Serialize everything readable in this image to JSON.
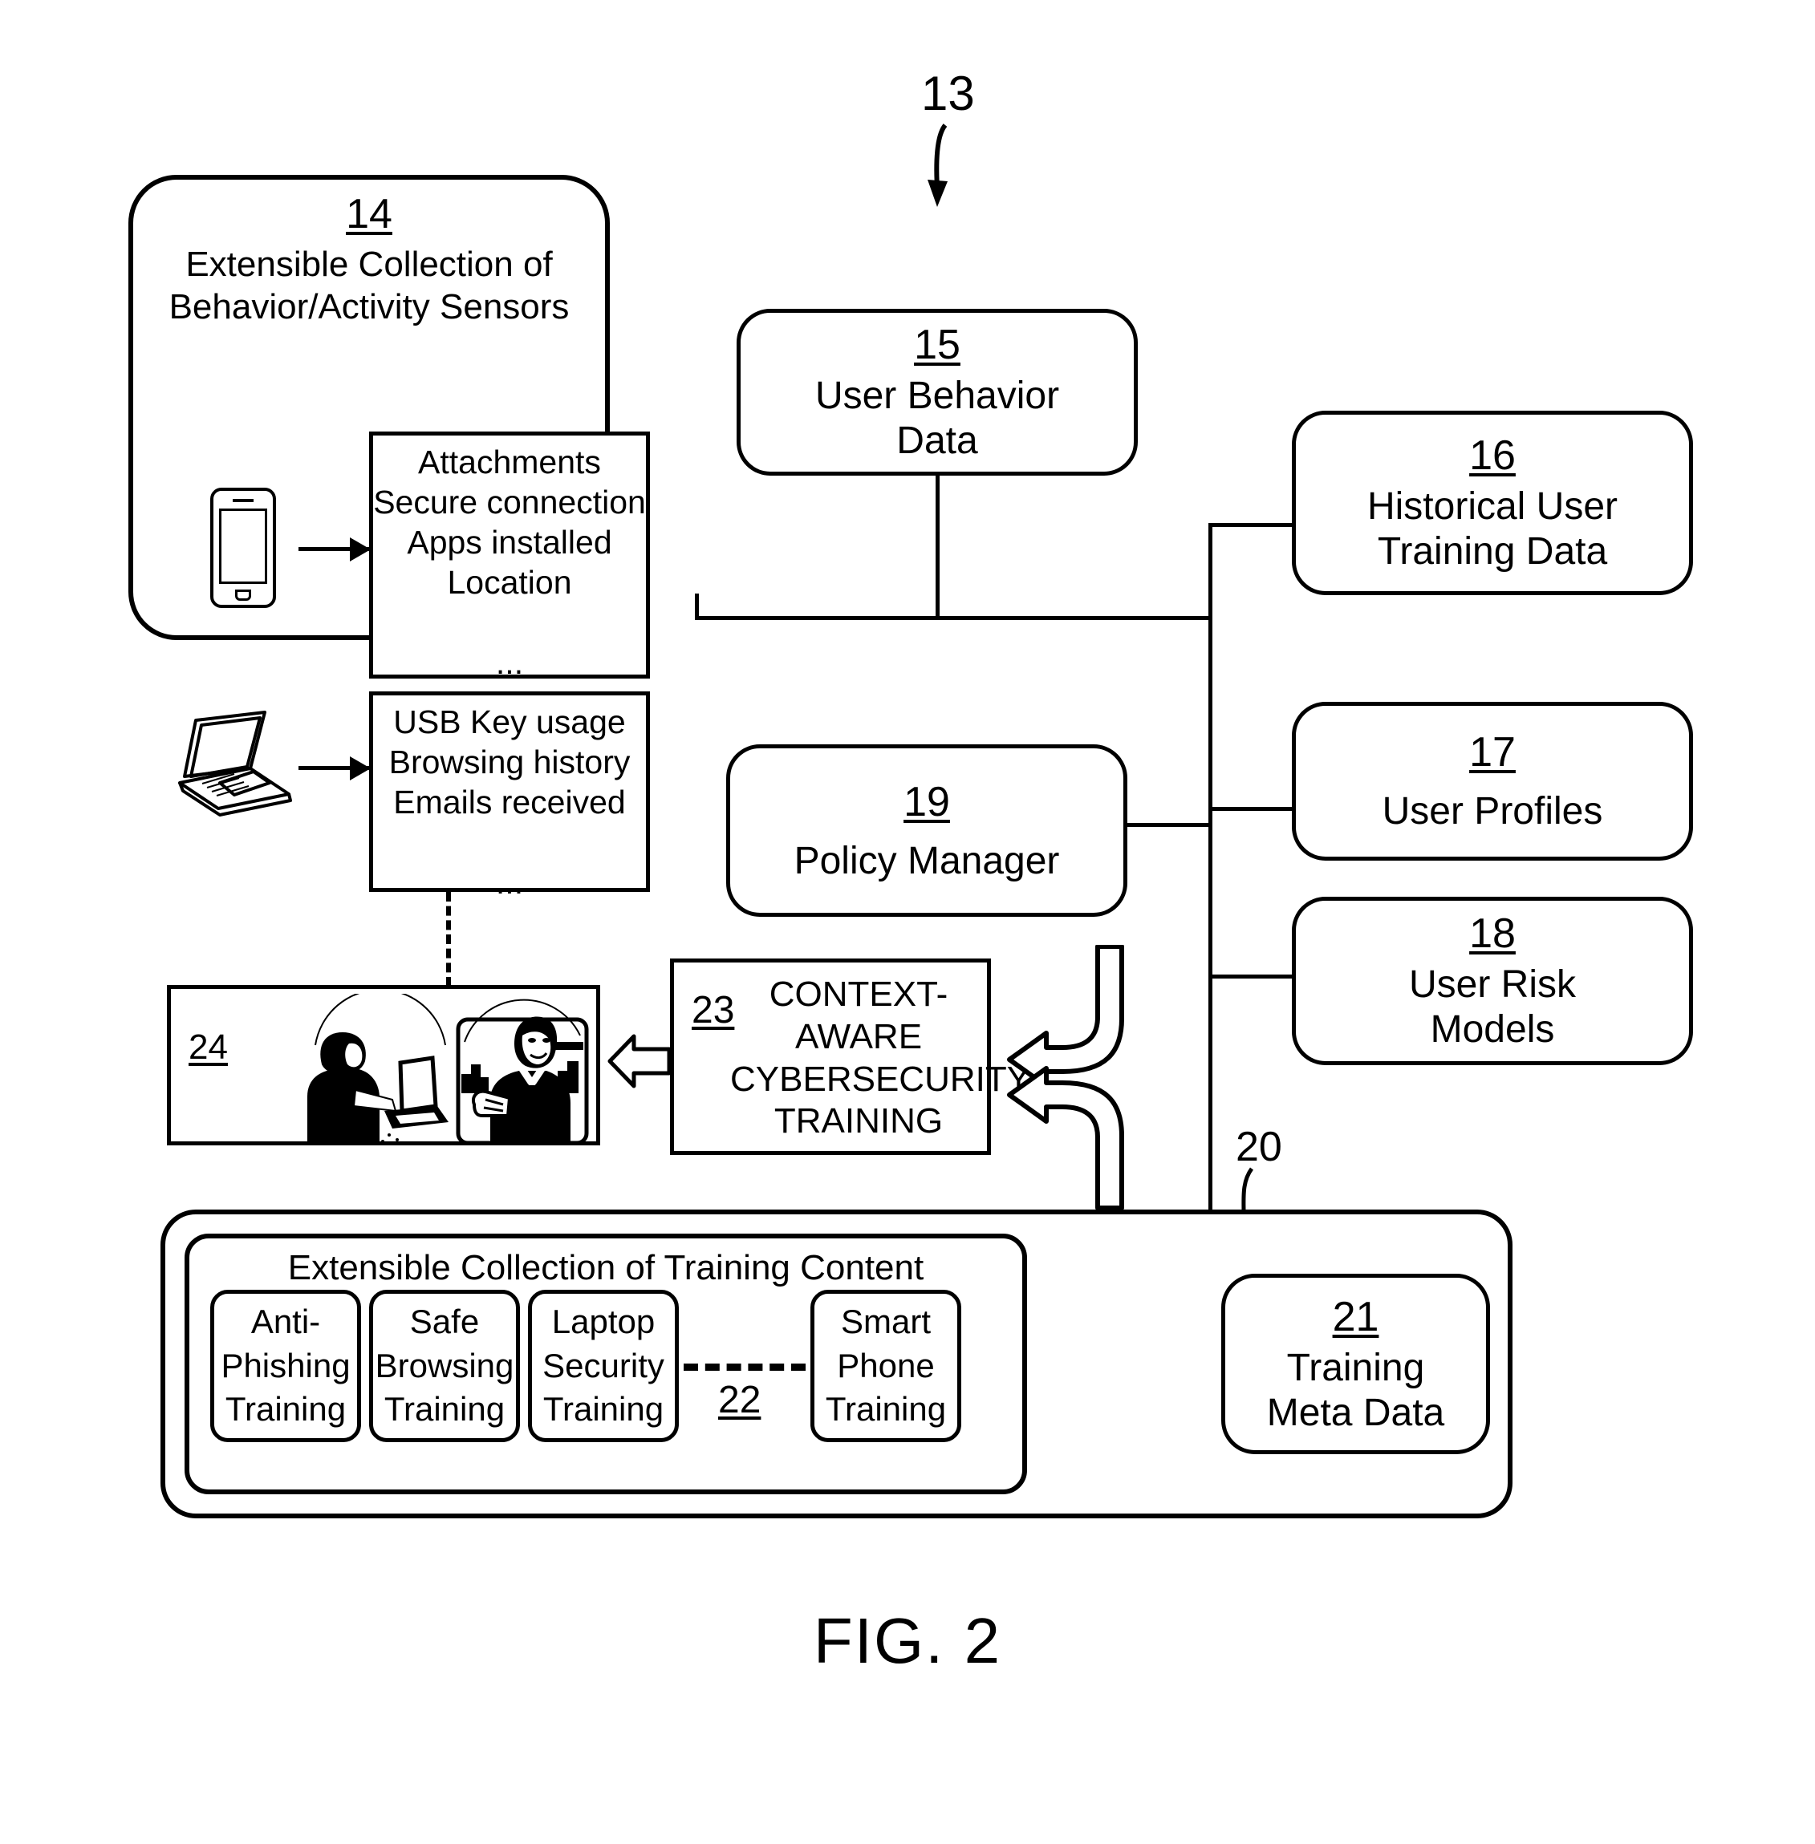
{
  "figure": {
    "caption": "FIG. 2",
    "system_ref": "13"
  },
  "sensors": {
    "ref": "14",
    "title": "Extensible Collection of\nBehavior/Activity Sensors",
    "phone_sensors": "Attachments\nSecure connection\nApps installed\nLocation\n\n...",
    "laptop_sensors": "USB Key usage\nBrowsing history\nEmails received\n\n...",
    "phone_icon_name": "smartphone-icon",
    "laptop_icon_name": "laptop-icon"
  },
  "user_behavior": {
    "ref": "15",
    "title": "User Behavior\nData"
  },
  "policy_manager": {
    "ref": "19",
    "title": "Policy Manager"
  },
  "context_training": {
    "ref": "23",
    "title": "CONTEXT-\nAWARE\nCYBERSECURITY\nTRAINING"
  },
  "delivered_training": {
    "ref": "24",
    "description": "Illustration of a woman at a laptop and a man presenting"
  },
  "data_stores": [
    {
      "ref": "16",
      "title": "Historical User\nTraining Data"
    },
    {
      "ref": "17",
      "title": "User Profiles"
    },
    {
      "ref": "18",
      "title": "User Risk\nModels"
    }
  ],
  "training_content": {
    "ref": "20",
    "inner_title": "Extensible Collection of Training Content",
    "module_ref": "22",
    "modules": [
      {
        "title": "Anti-\nPhishing\nTraining"
      },
      {
        "title": "Safe\nBrowsing\nTraining"
      },
      {
        "title": "Laptop\nSecurity\nTraining"
      },
      {
        "title": "Smart\nPhone\nTraining"
      }
    ],
    "meta": {
      "ref": "21",
      "title": "Training\nMeta Data"
    }
  },
  "colors": {
    "stroke": "#000000",
    "background": "#ffffff"
  }
}
